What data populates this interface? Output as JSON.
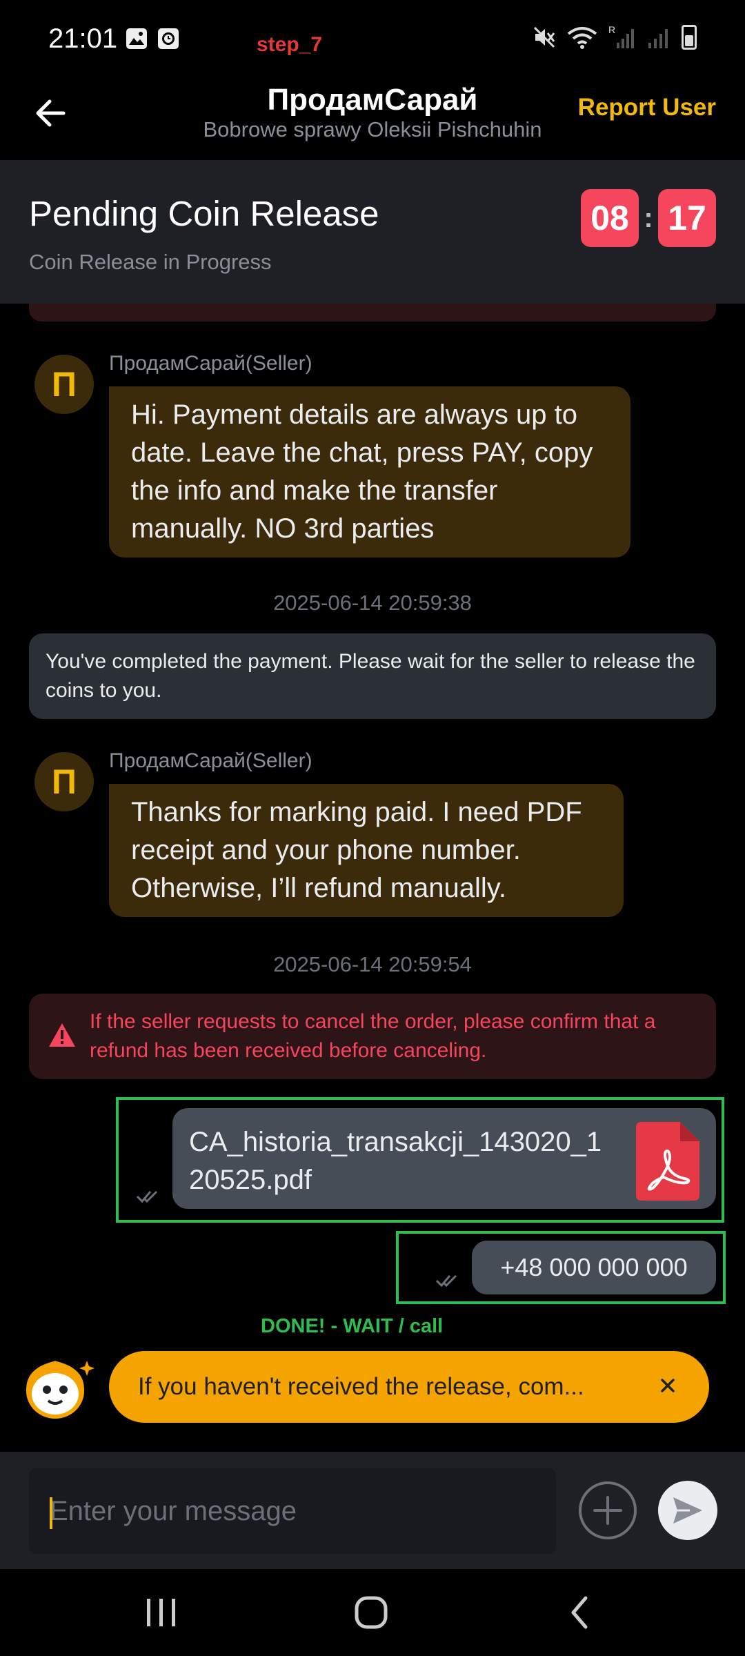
{
  "status_bar": {
    "time": "21:01",
    "step_label": "step_7",
    "icons": [
      "gallery-icon",
      "clock-icon",
      "mute-icon",
      "wifi-icon",
      "roaming-icon",
      "signal-icon",
      "battery-icon"
    ],
    "roaming_letter": "R"
  },
  "header": {
    "title": "ПродамСарай",
    "subtitle": "Bobrowe sprawy Oleksii Pishchuhin",
    "report_label": "Report User"
  },
  "pending": {
    "title": "Pending Coin Release",
    "subtitle": "Coin Release in Progress",
    "timer_minutes": "08",
    "timer_seconds": "17"
  },
  "messages": {
    "msg1": {
      "avatar_letter": "П",
      "sender": "ПродамСарай(Seller)",
      "text": "Hi. Payment details are always up to date. Leave the chat, press PAY, copy the info and make the transfer manually. NO 3rd parties"
    },
    "stamp1": "2025-06-14 20:59:38",
    "system1": "You've completed the payment. Please wait for the seller to release the coins to you.",
    "msg2": {
      "avatar_letter": "П",
      "sender": "ПродамСарай(Seller)",
      "text": "Thanks for marking paid. I need PDF receipt and your phone number. Otherwise, I’ll refund manually."
    },
    "stamp2": "2025-06-14 20:59:54",
    "warning": "If the seller requests to cancel the order, please confirm that a refund has been received before canceling.",
    "file_name": "CA_historia_transakcji_143020_120525.pdf",
    "phone": "+48 000 000 000",
    "done_note": "DONE! - WAIT / call"
  },
  "banner": {
    "text": "If you haven't received the release, com..."
  },
  "composer": {
    "placeholder": "Enter your message"
  },
  "colors": {
    "accent": "#f0b90b",
    "danger": "#f6465d",
    "annotation_green": "#2ebd4e",
    "seller_bubble": "#3b2b0a",
    "own_bubble": "#474d57"
  }
}
